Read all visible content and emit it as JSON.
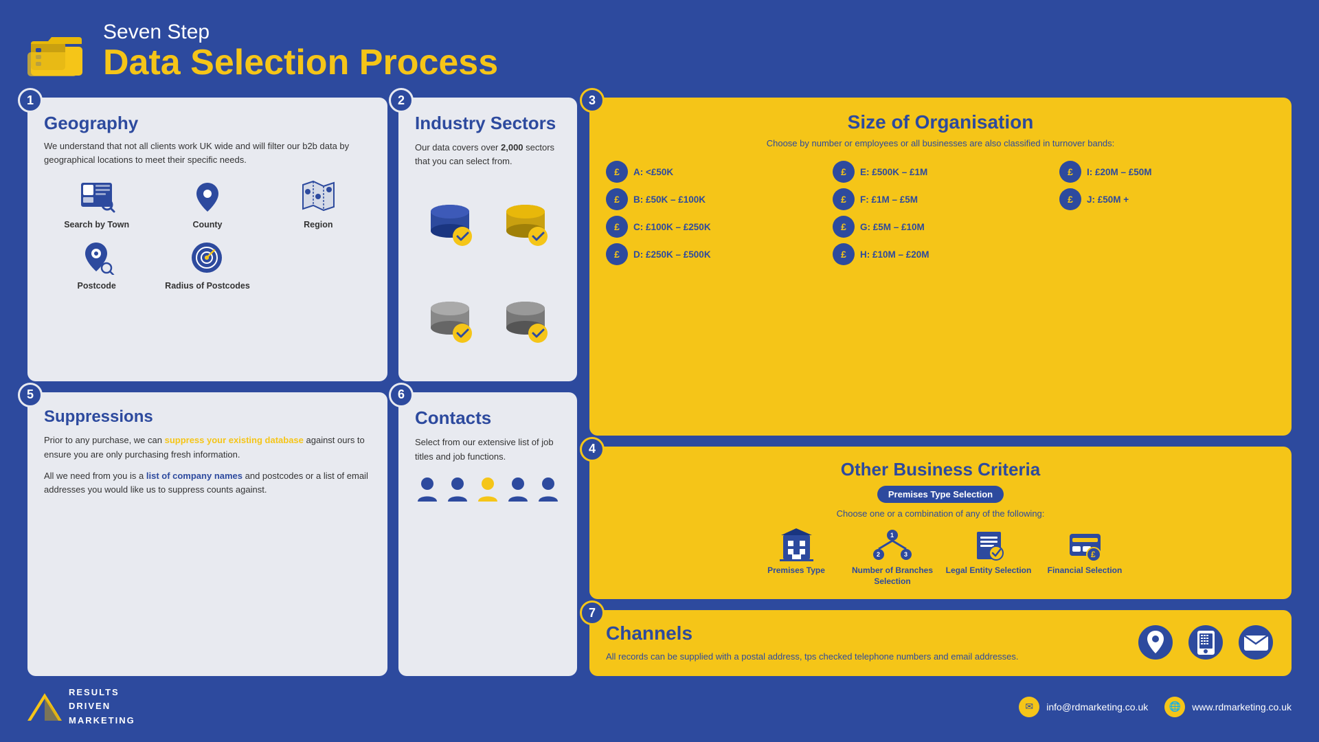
{
  "header": {
    "subtitle": "Seven Step",
    "title": "Data Selection Process"
  },
  "step1": {
    "number": "1",
    "title": "Geography",
    "description": "We understand that not all clients work UK wide and will filter our b2b data by geographical locations to meet their specific needs.",
    "icons": [
      {
        "label": "Search by Town",
        "name": "search-by-town"
      },
      {
        "label": "County",
        "name": "county"
      },
      {
        "label": "Region",
        "name": "region"
      },
      {
        "label": "Postcode",
        "name": "postcode"
      },
      {
        "label": "Radius of Postcodes",
        "name": "radius-of-postcodes"
      }
    ]
  },
  "step2": {
    "number": "2",
    "title": "Industry Sectors",
    "description": "Our data covers over 2,000 sectors that you can select from.",
    "highlight": "2,000"
  },
  "step3": {
    "number": "3",
    "title": "Size of Organisation",
    "subtitle": "Choose by number or employees or all businesses are also classified in turnover bands:",
    "bands": [
      {
        "label": "A: <£50K"
      },
      {
        "label": "E: £500K – £1M"
      },
      {
        "label": "I: £20M – £50M"
      },
      {
        "label": "B: £50K – £100K"
      },
      {
        "label": "F: £1M – £5M"
      },
      {
        "label": "J: £50M +"
      },
      {
        "label": "C: £100K – £250K"
      },
      {
        "label": "G: £5M – £10M"
      },
      {
        "label": ""
      },
      {
        "label": "D: £250K – £500K"
      },
      {
        "label": "H: £10M – £20M"
      },
      {
        "label": ""
      }
    ]
  },
  "step4": {
    "number": "4",
    "title": "Other Business Criteria",
    "badge": "Premises Type Selection",
    "subtitle": "Choose one or a combination of any of the following:",
    "criteria": [
      {
        "label": "Premises Type"
      },
      {
        "label": "Number of Branches Selection"
      },
      {
        "label": "Legal Entity Selection"
      },
      {
        "label": "Financial Selection"
      }
    ]
  },
  "step5": {
    "number": "5",
    "title": "Suppressions",
    "text1": "Prior to any purchase, we can suppress your existing database against ours to ensure you are only purchasing fresh information.",
    "text2_before": "All we need from you is a ",
    "highlight": "list of company names",
    "text2_after": " and postcodes or a list of email addresses you would like us to suppress counts against.",
    "suppress_highlight": "suppress your existing database"
  },
  "step6": {
    "number": "6",
    "title": "Contacts",
    "description": "Select from our extensive list of job titles and job functions."
  },
  "step7": {
    "number": "7",
    "title": "Channels",
    "description": "All records can be supplied with a postal address, tps checked telephone numbers and email addresses."
  },
  "footer": {
    "logo_line1": "RESULTS",
    "logo_line2": "DRIVEN",
    "logo_line3": "MARKETING",
    "email": "info@rdmarketing.co.uk",
    "website": "www.rdmarketing.co.uk"
  }
}
